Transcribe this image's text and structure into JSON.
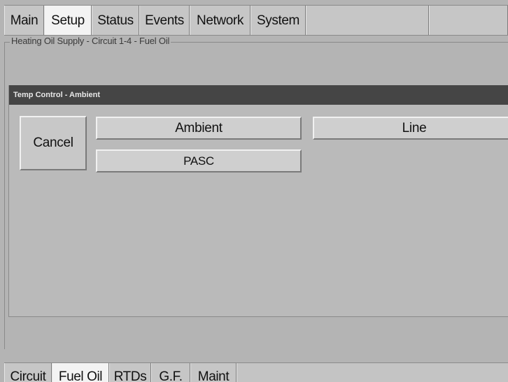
{
  "top_tabs": [
    {
      "label": "Main",
      "active": false
    },
    {
      "label": "Setup",
      "active": true
    },
    {
      "label": "Status",
      "active": false
    },
    {
      "label": "Events",
      "active": false
    },
    {
      "label": "Network",
      "active": false
    },
    {
      "label": "System",
      "active": false
    }
  ],
  "group": {
    "legend": "Heating Oil Supply - Circuit 1-4 - Fuel Oil"
  },
  "dialog": {
    "title": "Temp Control - Ambient",
    "cancel_label": "Cancel",
    "options": {
      "ambient": "Ambient",
      "line": "Line",
      "pasc": "PASC"
    }
  },
  "bottom_tabs": [
    {
      "label": "Circuit",
      "active": false
    },
    {
      "label": "Fuel Oil",
      "active": true
    },
    {
      "label": "RTDs",
      "active": false
    },
    {
      "label": "G.F.",
      "active": false
    },
    {
      "label": "Maint",
      "active": false
    }
  ],
  "colors": {
    "background": "#b4b4b4",
    "titlebar": "#454545",
    "active_tab": "#f3f3f3"
  }
}
